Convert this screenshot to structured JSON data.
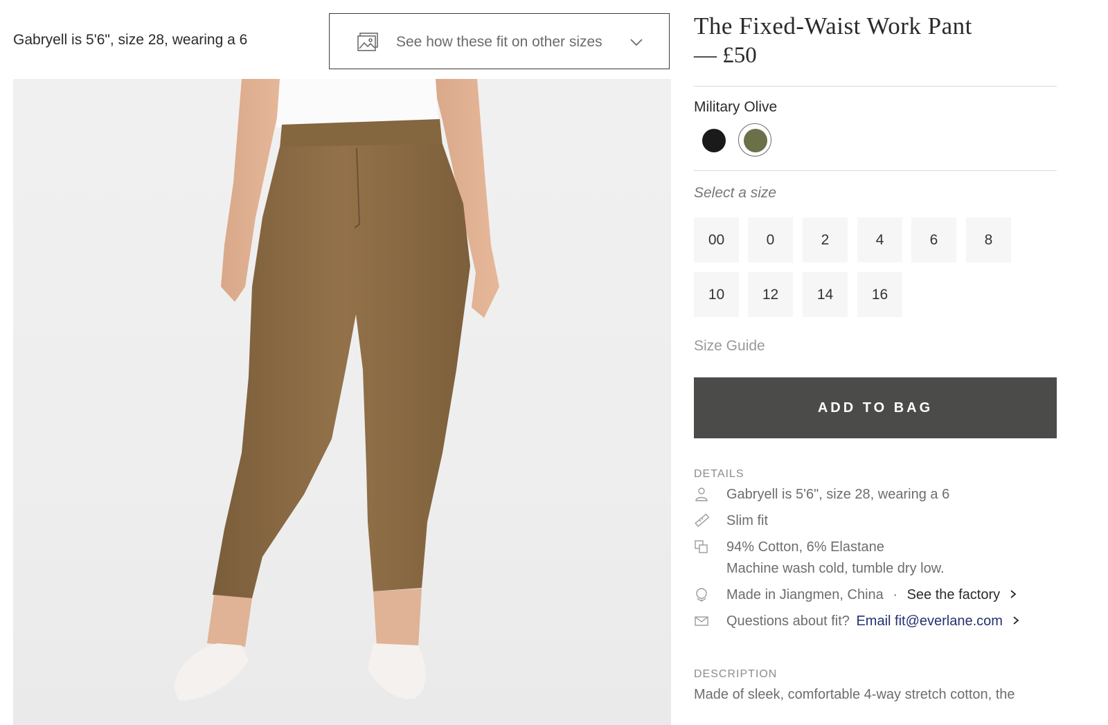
{
  "model_note": "Gabryell is 5'6\", size 28, wearing a 6",
  "fit_dropdown": {
    "label": "See how these fit on other sizes"
  },
  "product": {
    "title": "The Fixed-Waist Work Pant",
    "price": "— £50"
  },
  "color": {
    "selected_name": "Military Olive",
    "swatches": [
      {
        "name": "black",
        "hex": "#1a1a1a"
      },
      {
        "name": "military-olive",
        "hex": "#6b7049",
        "selected": true
      }
    ]
  },
  "sizes": {
    "label": "Select a size",
    "options": [
      "00",
      "0",
      "2",
      "4",
      "6",
      "8",
      "10",
      "12",
      "14",
      "16"
    ],
    "guide": "Size Guide"
  },
  "add_to_bag": "ADD TO BAG",
  "details": {
    "heading": "DETAILS",
    "model": "Gabryell is 5'6\", size 28, wearing a 6",
    "fit": "Slim fit",
    "fabric": "94% Cotton, 6% Elastane",
    "care": "Machine wash cold, tumble dry low.",
    "made_in": "Made in Jiangmen, China",
    "separator": "·",
    "factory_link": "See the factory",
    "questions": "Questions about fit?",
    "email_link": "Email fit@everlane.com"
  },
  "description": {
    "heading": "DESCRIPTION",
    "text": "Made of sleek, comfortable 4-way stretch cotton, the"
  },
  "colors": {
    "pant": "#8a6a43",
    "button_bg": "#4b4b49",
    "link_blue": "#23316f"
  }
}
